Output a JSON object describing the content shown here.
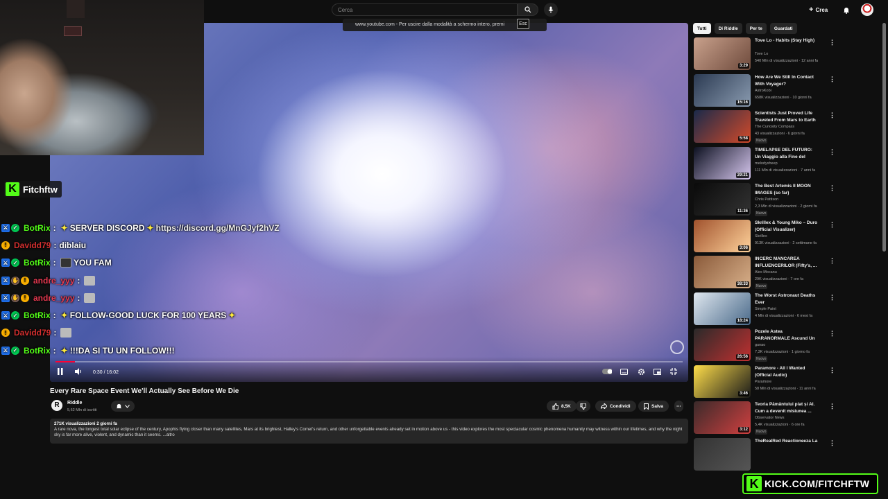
{
  "topbar": {
    "search_placeholder": "Cerca",
    "create_label": "Crea",
    "fullscreen_notice": "www.youtube.com - Per uscire dalla modalità a schermo intero, premi",
    "esc_key": "Esc"
  },
  "video": {
    "time": "0:30 / 16:02",
    "progress_fraction": 0.031,
    "title": "Every Rare Space Event We'll Actually See Before We Die"
  },
  "channel": {
    "name": "Riddle",
    "subs": "5,62 Mln di iscritti",
    "likes": "8,5K",
    "share_label": "Condividi",
    "save_label": "Salva"
  },
  "description": {
    "meta": "271K visualizzazioni  2 giorni fa",
    "text": "A rare nova, the longest total solar eclipse of the century, Apophis flying closer than many satellites, Mars at its brightest, Halley's Comet's return, and other unforgettable events already set in motion above us - this video explores the most spectacular cosmic phenomena humanity may witness within our lifetimes, and why the night sky is far more alive, violent, and dynamic than it seems. ...altro"
  },
  "chips": [
    "Tutti",
    "Di Riddle",
    "Per te",
    "Guardati"
  ],
  "recommendations": [
    {
      "title": "Tove Lo - Habits (Stay High)",
      "channel": "Tove Lo",
      "stats": "540 Mln di visualizzazioni · 12 anni fa",
      "duration": "3:29",
      "badge": ""
    },
    {
      "title": "How Are We Still In Contact With Voyager?",
      "channel": "AstroKobi",
      "stats": "658K visualizzazioni · 10 giorni fa",
      "duration": "15:16",
      "badge": ""
    },
    {
      "title": "Scientists Just Proved Life Traveled From Mars to Earth ...",
      "channel": "The Curiosity Compass",
      "stats": "43 visualizzazioni · 6 giorni fa",
      "duration": "5:58",
      "badge": "Nuovo"
    },
    {
      "title": "TIMELAPSE DEL FUTURO: Un Viaggio alla Fine del Tempo ...",
      "channel": "melodysheep",
      "stats": "111 Mln di visualizzazioni · 7 anni fa",
      "duration": "29:21",
      "badge": ""
    },
    {
      "title": "The Best Artemis II MOON IMAGES (so far)",
      "channel": "Chris Pattison",
      "stats": "2,3 Mln di visualizzazioni · 2 giorni fa",
      "duration": "11:36",
      "badge": "Nuovo"
    },
    {
      "title": "Skrillex & Young Miko – Duro (Official Visualizer)",
      "channel": "Skrillex",
      "stats": "913K visualizzazioni · 2 settimane fa",
      "duration": "3:06",
      "badge": ""
    },
    {
      "title": "INCERC MANCAREA INFLUENCERILOR (Fifty's, ...",
      "channel": "Alex Mocanu",
      "stats": "29K visualizzazioni · 7 ore fa",
      "duration": "38:33",
      "badge": "Nuovo"
    },
    {
      "title": "The Worst Astronaut Deaths Ever",
      "channel": "Simple Paint",
      "stats": "4 Mln di visualizzazioni · 6 mesi fa",
      "duration": "18:24",
      "badge": ""
    },
    {
      "title": "Pozele Astea PARANORMALE Ascund Un Secret (Shutter ...",
      "channel": "gunao",
      "stats": "7,3K visualizzazioni · 1 giorno fa",
      "duration": "26:56",
      "badge": "Nuovo"
    },
    {
      "title": "Paramore - All I Wanted (Official Audio)",
      "channel": "Paramore",
      "stats": "58 Mln di visualizzazioni · 11 anni fa",
      "duration": "3:46",
      "badge": ""
    },
    {
      "title": "Teoria Pământului plat și AI. Cum a devenit misiunea ...",
      "channel": "Observator News",
      "stats": "5,4K visualizzazioni · 6 ore fa",
      "duration": "3:12",
      "badge": "Nuovo"
    },
    {
      "title": "TheRealRed Reactioneeza La",
      "channel": "",
      "stats": "",
      "duration": "",
      "badge": ""
    }
  ],
  "stream": {
    "kick_name": "Fitchftw",
    "kick_url": "KICK.COM/FITCHFTW"
  },
  "chat": [
    {
      "user": "BotRix",
      "color": "#53fc18",
      "badges": [
        "mod",
        "ver"
      ],
      "msg": "SERVER DISCORD",
      "link": "https://discord.gg/MnGJyf2hVZ"
    },
    {
      "user": "Davidd79",
      "color": "#d32f2f",
      "badges": [
        "og"
      ],
      "msg": "diblaiu"
    },
    {
      "user": "BotRix",
      "color": "#53fc18",
      "badges": [
        "mod",
        "ver"
      ],
      "msg": "YOU FAM"
    },
    {
      "user": "andre_yyy",
      "color": "#e53950",
      "badges": [
        "mod",
        "hand",
        "og"
      ],
      "msg": ""
    },
    {
      "user": "andre_yyy",
      "color": "#e53950",
      "badges": [
        "mod",
        "hand",
        "og"
      ],
      "msg": ""
    },
    {
      "user": "BotRix",
      "color": "#53fc18",
      "badges": [
        "mod",
        "ver"
      ],
      "msg": "FOLLOW-GOOD LUCK FOR 100 YEARS"
    },
    {
      "user": "Davidd79",
      "color": "#d32f2f",
      "badges": [
        "og"
      ],
      "msg": ""
    },
    {
      "user": "BotRix",
      "color": "#53fc18",
      "badges": [
        "mod",
        "ver"
      ],
      "msg": "!!!DA SI TU UN FOLLOW!!!"
    }
  ]
}
